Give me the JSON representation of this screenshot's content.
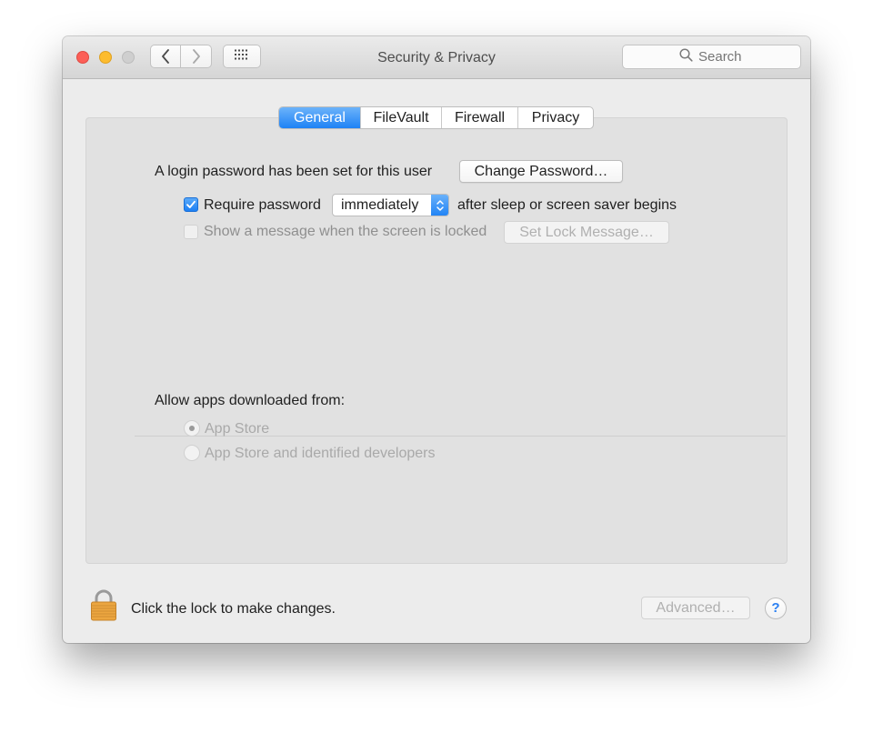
{
  "window": {
    "title": "Security & Privacy",
    "search_placeholder": "Search"
  },
  "tabs": [
    {
      "label": "General",
      "active": true
    },
    {
      "label": "FileVault",
      "active": false
    },
    {
      "label": "Firewall",
      "active": false
    },
    {
      "label": "Privacy",
      "active": false
    }
  ],
  "general": {
    "login_password_text": "A login password has been set for this user",
    "change_password_label": "Change Password…",
    "require_password": {
      "checked": true,
      "label": "Require password",
      "delay_value": "immediately",
      "suffix": "after sleep or screen saver begins"
    },
    "show_message": {
      "checked": false,
      "enabled": false,
      "label": "Show a message when the screen is locked",
      "button_label": "Set Lock Message…"
    },
    "allow_apps": {
      "heading": "Allow apps downloaded from:",
      "options": [
        {
          "label": "App Store",
          "selected": true,
          "enabled": false
        },
        {
          "label": "App Store and identified developers",
          "selected": false,
          "enabled": false
        }
      ]
    }
  },
  "footer": {
    "lock_text": "Click the lock to make changes.",
    "advanced_label": "Advanced…",
    "help_label": "?"
  },
  "colors": {
    "accent": "#1e82f5",
    "close": "#fc5f57",
    "minimize": "#fdbc2e",
    "zoom_disabled": "#cfcfcf",
    "lock_gold": "#e7a23c"
  },
  "icons": {
    "back": "chevron-left-icon",
    "forward": "chevron-right-icon",
    "show_all": "grid-icon",
    "search": "search-icon",
    "lock": "lock-icon",
    "checkmark": "checkmark-icon",
    "stepper": "updown-arrows-icon"
  }
}
